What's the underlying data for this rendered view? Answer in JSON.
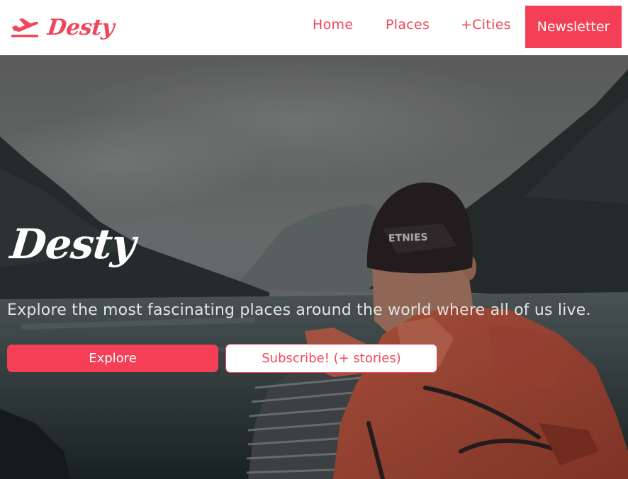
{
  "nav": {
    "brand": "Desty",
    "brand_icon": "airplane-takeoff-icon",
    "links": [
      "Home",
      "Places",
      "+Cities"
    ],
    "cta": "Newsletter"
  },
  "hero": {
    "title": "Desty",
    "subtitle": "Explore the most fascinating places around the world where all of us live.",
    "primary_button": "Explore",
    "secondary_button": "Subscribe! (+ stories)"
  },
  "colors": {
    "accent": "#f43f56",
    "navbar_bg": "#ffffff",
    "hero_text": "#ffffff"
  }
}
